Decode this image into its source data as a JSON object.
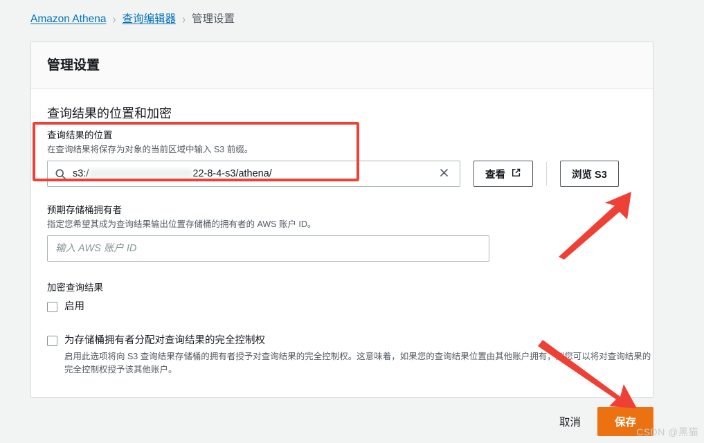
{
  "breadcrumb": {
    "items": [
      {
        "label": "Amazon Athena",
        "current": false
      },
      {
        "label": "查询编辑器",
        "current": false
      },
      {
        "label": "管理设置",
        "current": true
      }
    ],
    "separator": "›"
  },
  "card": {
    "header_title": "管理设置",
    "section_title": "查询结果的位置和加密",
    "results_location": {
      "label": "查询结果的位置",
      "description": "在查询结果将保存为对象的当前区域中输入 S3 前缀。",
      "value_prefix": "s3:/",
      "value_suffix": "22-8-4-s3/athena/",
      "search_icon": "search-icon",
      "clear_icon": "close-icon",
      "view_button": "查看",
      "view_button_icon": "external-link-icon",
      "browse_button": "浏览 S3"
    },
    "expected_owner": {
      "label": "预期存储桶拥有者",
      "description": "指定您希望其成为查询结果输出位置存储桶的拥有者的 AWS 账户 ID。",
      "placeholder": "输入 AWS 账户 ID",
      "value": ""
    },
    "encryption": {
      "label": "加密查询结果",
      "enable_label": "启用",
      "enable_checked": false
    },
    "full_control": {
      "label": "为存储桶拥有者分配对查询结果的完全控制权",
      "checked": false,
      "description": "启用此选项将向 S3 查询结果存储桶的拥有者授予对查询结果的完全控制权。这意味着，如果您的查询结果位置由其他账户拥有，则您可以将对查询结果的完全控制权授予该其他账户。"
    }
  },
  "footer": {
    "cancel_label": "取消",
    "save_label": "保存"
  },
  "annotations": {
    "highlight_color": "#ef4036",
    "arrow_color": "#ef4036",
    "arrow_browse_target": "浏览 S3",
    "arrow_save_target": "保存"
  },
  "watermark": "CSDN @黑猫",
  "colors": {
    "link": "#0073bb",
    "save_button": "#ec7211",
    "page_background": "#f2f3f3",
    "card_background": "#ffffff",
    "card_header_background": "#fafafa"
  }
}
